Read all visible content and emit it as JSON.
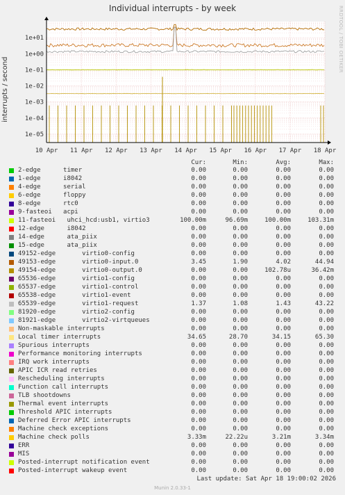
{
  "title": "Individual interrupts - by week",
  "side_label": "RRDTOOL / TOBI OETIKER",
  "footer": {
    "last_update": "Last update:  Sat Apr 18 19:00:02 2026",
    "version": "Munin 2.0.33-1"
  },
  "columns": {
    "cur": "Cur:",
    "min": "Min:",
    "avg": "Avg:",
    "max": "Max:"
  },
  "chart_data": {
    "type": "line",
    "title": "Individual interrupts - by week",
    "ylabel": "interrupts / second",
    "xlabel": "",
    "y_scale": "log",
    "ylim": [
      3e-06,
      100
    ],
    "y_ticks": [
      {
        "value": 10,
        "label": "1e+01"
      },
      {
        "value": 1,
        "label": "1e+00"
      },
      {
        "value": 0.1,
        "label": "1e-01"
      },
      {
        "value": 0.01,
        "label": "1e-02"
      },
      {
        "value": 0.001,
        "label": "1e-03"
      },
      {
        "value": 0.0001,
        "label": "1e-04"
      },
      {
        "value": 1e-05,
        "label": "1e-05"
      }
    ],
    "x_ticks": [
      "10 Apr",
      "11 Apr",
      "12 Apr",
      "13 Apr",
      "14 Apr",
      "15 Apr",
      "16 Apr",
      "17 Apr",
      "18 Apr"
    ],
    "grid": true,
    "series": [
      {
        "name": "Local timer interrupts",
        "color": "#b36b00",
        "approx": 34.65,
        "peak": 65.3
      },
      {
        "name": "49153-edge virtio0-input.0",
        "color": "#cc7a29",
        "approx": 3.45,
        "peak": 44.94
      },
      {
        "name": "65539-edge virtio1-request",
        "color": "#a0a0a0",
        "approx": 1.37,
        "peak": 43.22
      },
      {
        "name": "11-fasteoi uhci_hcd:usb1, virtio3",
        "color": "#b8c400",
        "approx": 0.1,
        "peak": 0.10331
      },
      {
        "name": "Machine check polls",
        "color": "#d4b84a",
        "approx": 0.00333,
        "peak": 0.00334
      }
    ],
    "rows": [
      {
        "color": "#00cc00",
        "label": "2-edge      timer",
        "cur": "0.00",
        "min": "0.00",
        "avg": "0.00",
        "max": "0.00"
      },
      {
        "color": "#0066b3",
        "label": "1-edge      i8042",
        "cur": "0.00",
        "min": "0.00",
        "avg": "0.00",
        "max": "0.00"
      },
      {
        "color": "#ff8000",
        "label": "4-edge      serial",
        "cur": "0.00",
        "min": "0.00",
        "avg": "0.00",
        "max": "0.00"
      },
      {
        "color": "#ffcc00",
        "label": "6-edge      floppy",
        "cur": "0.00",
        "min": "0.00",
        "avg": "0.00",
        "max": "0.00"
      },
      {
        "color": "#330099",
        "label": "8-edge      rtc0",
        "cur": "0.00",
        "min": "0.00",
        "avg": "0.00",
        "max": "0.00"
      },
      {
        "color": "#990099",
        "label": "9-fasteoi   acpi",
        "cur": "0.00",
        "min": "0.00",
        "avg": "0.00",
        "max": "0.00"
      },
      {
        "color": "#ccff00",
        "label": "11-fasteoi   uhci_hcd:usb1, virtio3",
        "cur": "100.00m",
        "min": "96.69m",
        "avg": "100.00m",
        "max": "103.31m"
      },
      {
        "color": "#ff0000",
        "label": "12-edge      i8042",
        "cur": "0.00",
        "min": "0.00",
        "avg": "0.00",
        "max": "0.00"
      },
      {
        "color": "#808080",
        "label": "14-edge      ata_piix",
        "cur": "0.00",
        "min": "0.00",
        "avg": "0.00",
        "max": "0.00"
      },
      {
        "color": "#008f00",
        "label": "15-edge      ata_piix",
        "cur": "0.00",
        "min": "0.00",
        "avg": "0.00",
        "max": "0.00"
      },
      {
        "color": "#00487d",
        "label": "49152-edge       virtio0-config",
        "cur": "0.00",
        "min": "0.00",
        "avg": "0.00",
        "max": "0.00"
      },
      {
        "color": "#b35a00",
        "label": "49153-edge       virtio0-input.0",
        "cur": "3.45",
        "min": "1.90",
        "avg": "4.02",
        "max": "44.94"
      },
      {
        "color": "#b38f00",
        "label": "49154-edge       virtio0-output.0",
        "cur": "0.00",
        "min": "0.00",
        "avg": "102.78u",
        "max": "36.42m"
      },
      {
        "color": "#6b006b",
        "label": "65536-edge       virtio1-config",
        "cur": "0.00",
        "min": "0.00",
        "avg": "0.00",
        "max": "0.00"
      },
      {
        "color": "#8fb300",
        "label": "65537-edge       virtio1-control",
        "cur": "0.00",
        "min": "0.00",
        "avg": "0.00",
        "max": "0.00"
      },
      {
        "color": "#b30000",
        "label": "65538-edge       virtio1-event",
        "cur": "0.00",
        "min": "0.00",
        "avg": "0.00",
        "max": "0.00"
      },
      {
        "color": "#bebebe",
        "label": "65539-edge       virtio1-request",
        "cur": "1.37",
        "min": "1.08",
        "avg": "1.43",
        "max": "43.22"
      },
      {
        "color": "#80ff80",
        "label": "81920-edge       virtio2-config",
        "cur": "0.00",
        "min": "0.00",
        "avg": "0.00",
        "max": "0.00"
      },
      {
        "color": "#80c9ff",
        "label": "81921-edge       virtio2-virtqueues",
        "cur": "0.00",
        "min": "0.00",
        "avg": "0.00",
        "max": "0.00"
      },
      {
        "color": "#ffc080",
        "label": "Non-maskable interrupts",
        "cur": "0.00",
        "min": "0.00",
        "avg": "0.00",
        "max": "0.00"
      },
      {
        "color": "#ffe680",
        "label": "Local timer interrupts",
        "cur": "34.65",
        "min": "28.70",
        "avg": "34.15",
        "max": "65.30"
      },
      {
        "color": "#aa80ff",
        "label": "Spurious interrupts",
        "cur": "0.00",
        "min": "0.00",
        "avg": "0.00",
        "max": "0.00"
      },
      {
        "color": "#ee00cc",
        "label": "Performance monitoring interrupts",
        "cur": "0.00",
        "min": "0.00",
        "avg": "0.00",
        "max": "0.00"
      },
      {
        "color": "#ff8080",
        "label": "IRQ work interrupts",
        "cur": "0.00",
        "min": "0.00",
        "avg": "0.00",
        "max": "0.00"
      },
      {
        "color": "#666600",
        "label": "APIC ICR read retries",
        "cur": "0.00",
        "min": "0.00",
        "avg": "0.00",
        "max": "0.00"
      },
      {
        "color": "#ffbfff",
        "label": "Rescheduling interrupts",
        "cur": "0.00",
        "min": "0.00",
        "avg": "0.00",
        "max": "0.00"
      },
      {
        "color": "#00ffcc",
        "label": "Function call interrupts",
        "cur": "0.00",
        "min": "0.00",
        "avg": "0.00",
        "max": "0.00"
      },
      {
        "color": "#cc6699",
        "label": "TLB shootdowns",
        "cur": "0.00",
        "min": "0.00",
        "avg": "0.00",
        "max": "0.00"
      },
      {
        "color": "#999900",
        "label": "Thermal event interrupts",
        "cur": "0.00",
        "min": "0.00",
        "avg": "0.00",
        "max": "0.00"
      },
      {
        "color": "#00cc00",
        "label": "Threshold APIC interrupts",
        "cur": "0.00",
        "min": "0.00",
        "avg": "0.00",
        "max": "0.00"
      },
      {
        "color": "#0066b3",
        "label": "Deferred Error APIC interrupts",
        "cur": "0.00",
        "min": "0.00",
        "avg": "0.00",
        "max": "0.00"
      },
      {
        "color": "#ff8000",
        "label": "Machine check exceptions",
        "cur": "0.00",
        "min": "0.00",
        "avg": "0.00",
        "max": "0.00"
      },
      {
        "color": "#ffcc00",
        "label": "Machine check polls",
        "cur": "3.33m",
        "min": "22.22u",
        "avg": "3.21m",
        "max": "3.34m"
      },
      {
        "color": "#330099",
        "label": "ERR",
        "cur": "0.00",
        "min": "0.00",
        "avg": "0.00",
        "max": "0.00"
      },
      {
        "color": "#990099",
        "label": "MIS",
        "cur": "0.00",
        "min": "0.00",
        "avg": "0.00",
        "max": "0.00"
      },
      {
        "color": "#ccff00",
        "label": "Posted-interrupt notification event",
        "cur": "0.00",
        "min": "0.00",
        "avg": "0.00",
        "max": "0.00"
      },
      {
        "color": "#ff0000",
        "label": "Posted-interrupt wakeup event",
        "cur": "0.00",
        "min": "0.00",
        "avg": "0.00",
        "max": "0.00"
      }
    ]
  }
}
